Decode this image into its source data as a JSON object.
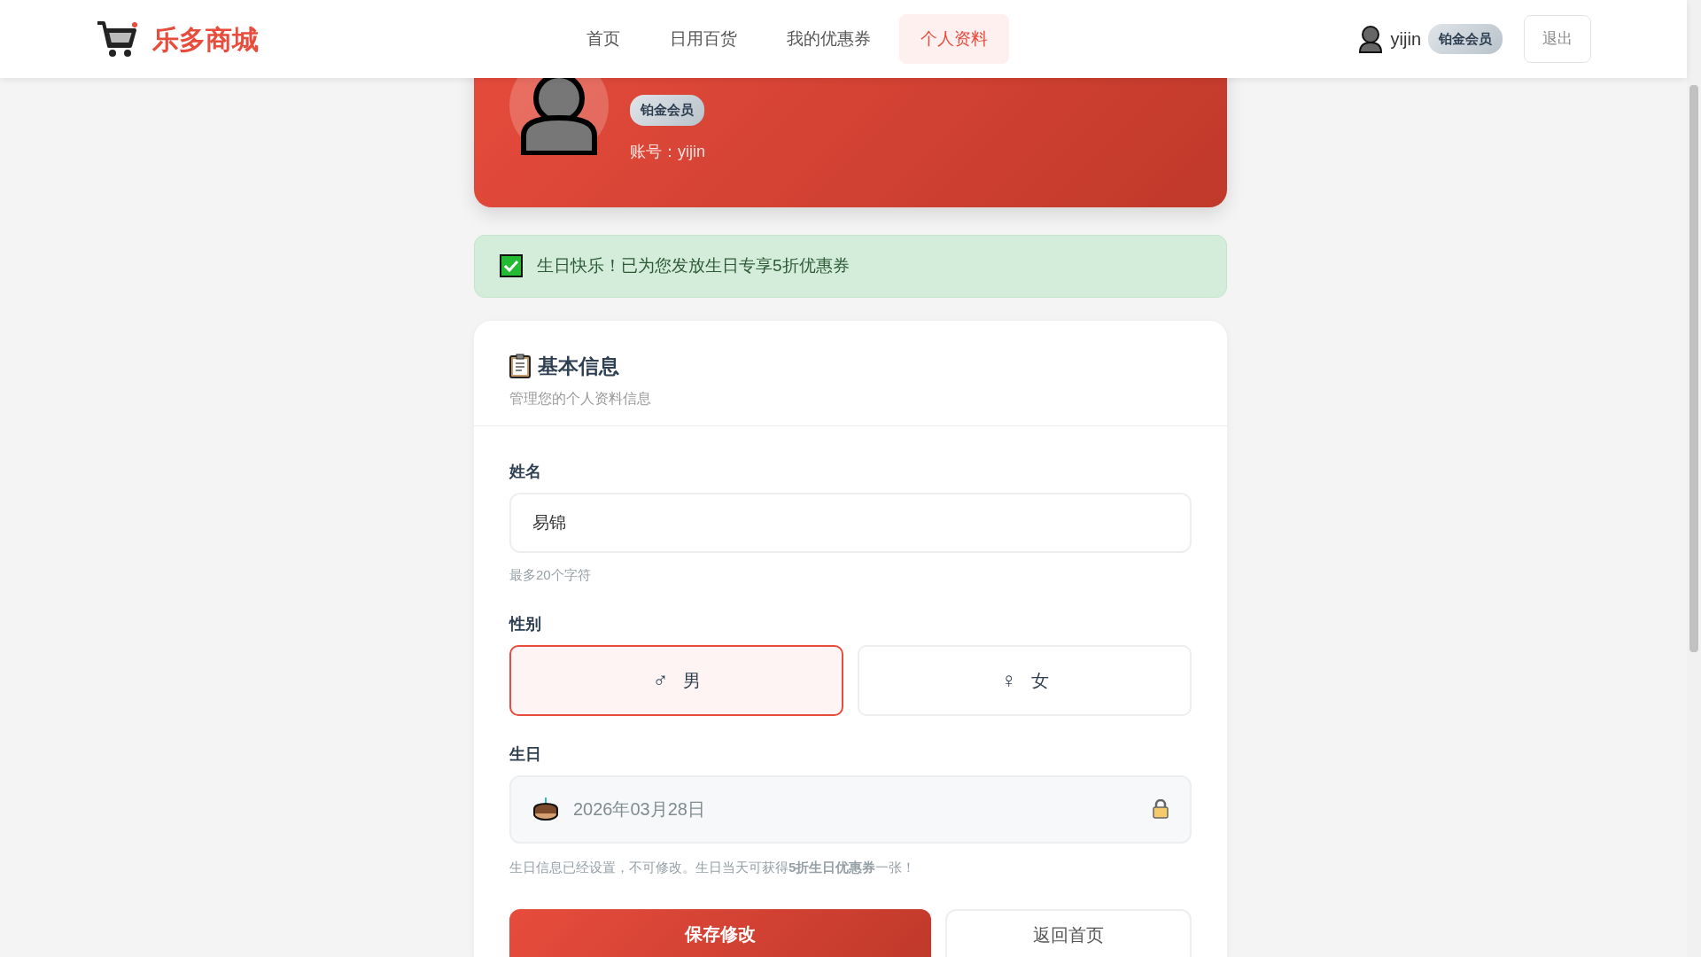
{
  "brand": {
    "name": "乐多商城"
  },
  "nav": [
    {
      "label": "首页",
      "selected": false
    },
    {
      "label": "日用百货",
      "selected": false
    },
    {
      "label": "我的优惠券",
      "selected": false
    },
    {
      "label": "个人资料",
      "selected": true
    }
  ],
  "user": {
    "name": "yijin",
    "tier": "铂金会员",
    "logout": "退出"
  },
  "profile": {
    "tier": "铂金会员",
    "account": "账号：yijin"
  },
  "alert": {
    "text": "生日快乐！已为您发放生日专享5折优惠券"
  },
  "form": {
    "title": "基本信息",
    "subtitle": "管理您的个人资料信息",
    "name": {
      "label": "姓名",
      "value": "易锦",
      "hint": "最多20个字符"
    },
    "gender": {
      "label": "性别",
      "options": [
        {
          "label": "男",
          "symbol": "♂",
          "selected": true
        },
        {
          "label": "女",
          "symbol": "♀",
          "selected": false
        }
      ]
    },
    "birthday": {
      "label": "生日",
      "value": "2026年03月28日",
      "locked": true,
      "note": "生日信息已经设置，不可修改。生日当天可获得**5折生日优惠券**一张！"
    },
    "buttons": {
      "save": "保存修改",
      "back": "返回首页"
    }
  }
}
